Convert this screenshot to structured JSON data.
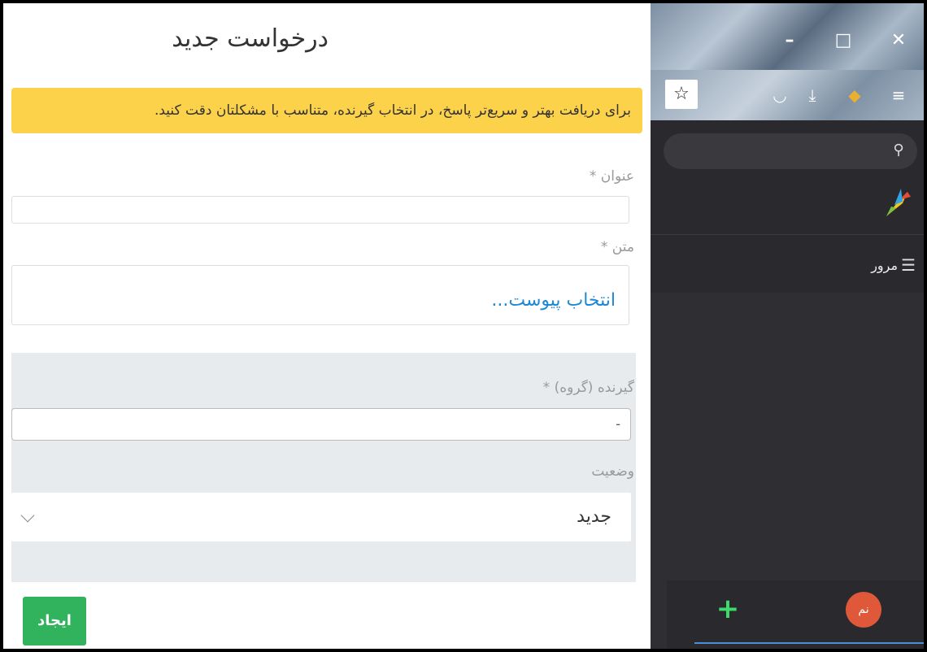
{
  "form": {
    "title": "درخواست جدید",
    "alert_text": "برای دریافت بهتر و سریع‌تر پاسخ، در انتخاب گیرنده، متناسب با مشکلتان دقت کنید.",
    "title_label": "عنوان *",
    "body_label": "متن *",
    "attach_link": "انتخاب پیوست...",
    "recipient_label": "گیرنده (گروه) *",
    "recipient_value": "-",
    "status_label": "وضعیت",
    "status_value": "جدید",
    "create_button": "ایجاد"
  },
  "browser": {
    "window_buttons": {
      "minimize": "–",
      "maximize": "□",
      "close": "✕"
    },
    "nav_item_label": "مرور",
    "avatar_initials": "نم",
    "plus_label": "+"
  },
  "colors": {
    "alert_bg": "#fbd24a",
    "create_button_bg": "#31b25d",
    "link": "#1e88d6",
    "sidebar_bg": "#2a2a2e",
    "avatar_bg": "#e0583a",
    "plus": "#3ddc6a"
  }
}
